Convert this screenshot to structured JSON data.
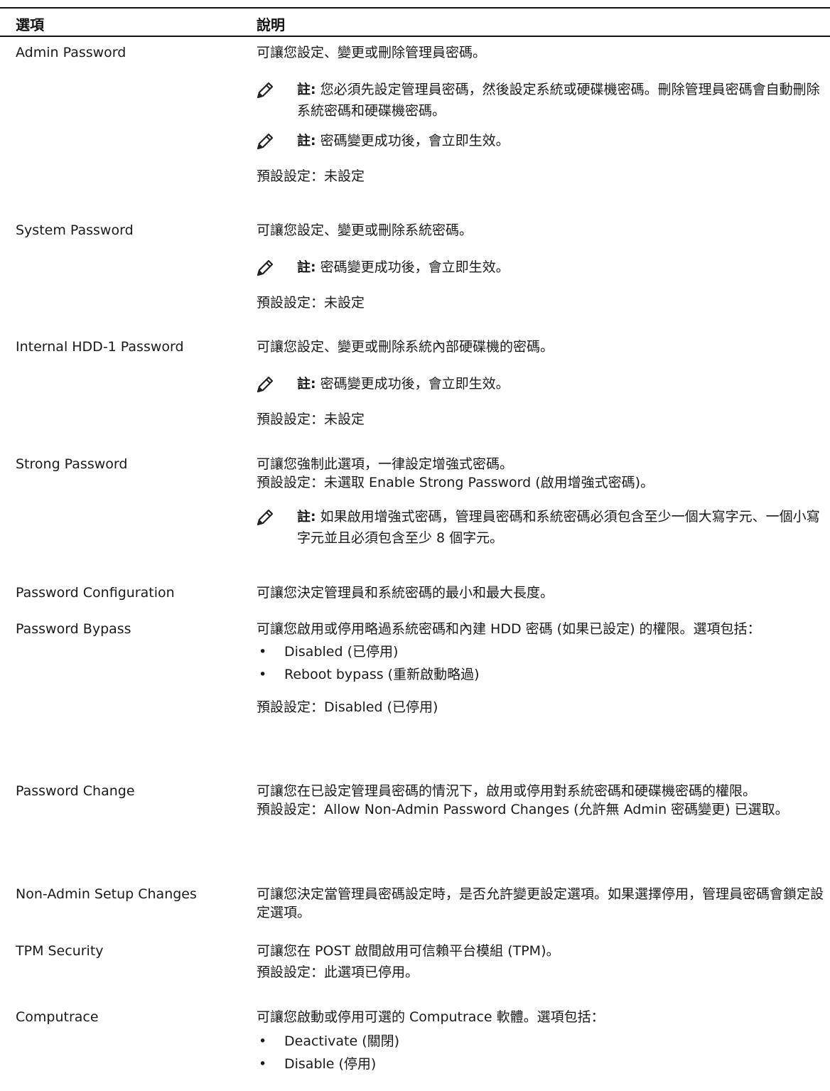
{
  "header": {
    "col_option": "選項",
    "col_description": "說明"
  },
  "note_label": "註:",
  "rows": [
    {
      "option": "Admin Password",
      "line1": "可讓您設定、變更或刪除管理員密碼。",
      "note1": "您必須先設定管理員密碼，然後設定系統或硬碟機密碼。刪除管理員密碼會自動刪除系統密碼和硬碟機密碼。",
      "note2": "密碼變更成功後，會立即生效。",
      "default": "預設設定：未設定"
    },
    {
      "option": "System Password",
      "line1": "可讓您設定、變更或刪除系統密碼。",
      "note1": "密碼變更成功後，會立即生效。",
      "default": "預設設定：未設定"
    },
    {
      "option": "Internal HDD-1 Password",
      "line1": "可讓您設定、變更或刪除系統內部硬碟機的密碼。",
      "note1": "密碼變更成功後，會立即生效。",
      "default": "預設設定：未設定"
    },
    {
      "option": "Strong Password",
      "line1": "可讓您強制此選項，一律設定增強式密碼。",
      "line2": "預設設定：未選取 Enable Strong Password (啟用增強式密碼)。",
      "note1": "如果啟用增強式密碼，管理員密碼和系統密碼必須包含至少一個大寫字元、一個小寫字元並且必須包含至少 8 個字元。"
    },
    {
      "option": "Password Configuration",
      "line1": "可讓您決定管理員和系統密碼的最小和最大長度。"
    },
    {
      "option": "Password Bypass",
      "line1": "可讓您啟用或停用略過系統密碼和內建 HDD 密碼 (如果已設定) 的權限。選項包括：",
      "bullets": [
        "Disabled (已停用)",
        "Reboot bypass (重新啟動略過)"
      ],
      "default": "預設設定：Disabled (已停用)"
    },
    {
      "option": "Password Change",
      "line1": "可讓您在已設定管理員密碼的情況下，啟用或停用對系統密碼和硬碟機密碼的權限。",
      "line2": "預設設定：Allow Non-Admin Password Changes (允許無 Admin 密碼變更) 已選取。"
    },
    {
      "option": "Non-Admin Setup Changes",
      "line1": "可讓您決定當管理員密碼設定時，是否允許變更設定選項。如果選擇停用，管理員密碼會鎖定設定選項。"
    },
    {
      "option": "TPM Security",
      "line1": "可讓您在 POST 啟間啟用可信賴平台模組 (TPM)。",
      "line2": "預設設定：此選項已停用。"
    },
    {
      "option": "Computrace",
      "line1": "可讓您啟動或停用可選的 Computrace 軟體。選項包括：",
      "bullets": [
        "Deactivate (關閉)",
        "Disable (停用)"
      ]
    }
  ]
}
